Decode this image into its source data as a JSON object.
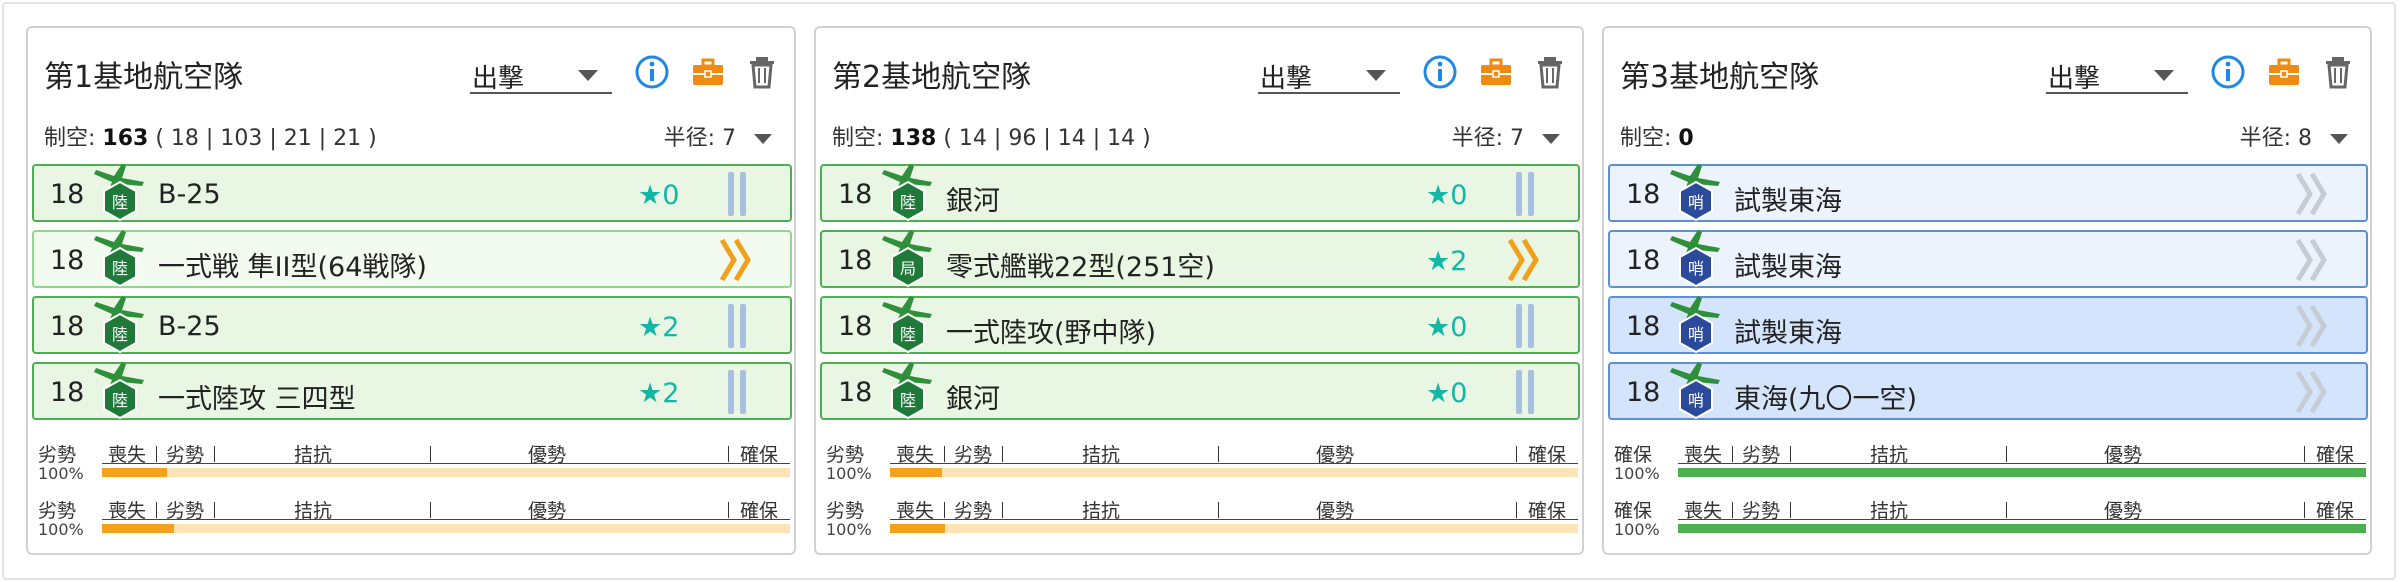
{
  "panels": [
    {
      "title": "第1基地航空隊",
      "mode": "出撃",
      "air_power_label": "制空:",
      "air_power": "163",
      "air_power_detail": "( 18 | 103 | 21 | 21 )",
      "radius_label": "半径:",
      "radius": "7",
      "slots": [
        {
          "count": "18",
          "name": "B-25",
          "star": "★0",
          "proficiency": "bars",
          "badge": "陸",
          "style": "green"
        },
        {
          "count": "18",
          "name": "一式戦 隼II型(64戦隊)",
          "star": "",
          "proficiency": "chevrons",
          "badge": "陸",
          "style": "light"
        },
        {
          "count": "18",
          "name": "B-25",
          "star": "★2",
          "proficiency": "bars",
          "badge": "陸",
          "style": "green"
        },
        {
          "count": "18",
          "name": "一式陸攻 三四型",
          "star": "★2",
          "proficiency": "bars",
          "badge": "陸",
          "style": "green"
        }
      ],
      "bars": [
        {
          "state": "劣勢",
          "pct": "100%",
          "fill": 0.095,
          "color": "orange"
        },
        {
          "state": "劣勢",
          "pct": "100%",
          "fill": 0.105,
          "color": "orange"
        }
      ]
    },
    {
      "title": "第2基地航空隊",
      "mode": "出撃",
      "air_power_label": "制空:",
      "air_power": "138",
      "air_power_detail": "( 14 | 96 | 14 | 14 )",
      "radius_label": "半径:",
      "radius": "7",
      "slots": [
        {
          "count": "18",
          "name": "銀河",
          "star": "★0",
          "proficiency": "bars",
          "badge": "陸",
          "style": "green"
        },
        {
          "count": "18",
          "name": "零式艦戦22型(251空)",
          "star": "★2",
          "proficiency": "chevrons",
          "badge": "局",
          "style": "green"
        },
        {
          "count": "18",
          "name": "一式陸攻(野中隊)",
          "star": "★0",
          "proficiency": "bars",
          "badge": "陸",
          "style": "green"
        },
        {
          "count": "18",
          "name": "銀河",
          "star": "★0",
          "proficiency": "bars",
          "badge": "陸",
          "style": "green"
        }
      ],
      "bars": [
        {
          "state": "劣勢",
          "pct": "100%",
          "fill": 0.075,
          "color": "orange"
        },
        {
          "state": "劣勢",
          "pct": "100%",
          "fill": 0.08,
          "color": "orange"
        }
      ]
    },
    {
      "title": "第3基地航空隊",
      "mode": "出撃",
      "air_power_label": "制空:",
      "air_power": "0",
      "air_power_detail": "",
      "radius_label": "半径:",
      "radius": "8",
      "slots": [
        {
          "count": "18",
          "name": "試製東海",
          "star": "",
          "proficiency": "chevrons-gray",
          "badge": "哨",
          "style": "blue"
        },
        {
          "count": "18",
          "name": "試製東海",
          "star": "",
          "proficiency": "chevrons-gray",
          "badge": "哨",
          "style": "blue"
        },
        {
          "count": "18",
          "name": "試製東海",
          "star": "",
          "proficiency": "chevrons-gray",
          "badge": "哨",
          "style": "blue2"
        },
        {
          "count": "18",
          "name": "東海(九〇一空)",
          "star": "",
          "proficiency": "chevrons-gray",
          "badge": "哨",
          "style": "blue2"
        }
      ],
      "bars": [
        {
          "state": "確保",
          "pct": "100%",
          "fill": 1.0,
          "color": "green"
        },
        {
          "state": "確保",
          "pct": "100%",
          "fill": 1.0,
          "color": "green"
        }
      ]
    }
  ],
  "scale_labels": {
    "loss": "喪失",
    "inferior": "劣勢",
    "parity": "拮抗",
    "superior": "優勢",
    "supremacy": "確保"
  },
  "colors": {
    "green_badge": "#1f7a3a",
    "blue_badge": "#2c4a9a",
    "star": "#13b7a6",
    "orange": "#f6a11c",
    "green": "#4caf50",
    "info": "#1e88e5",
    "briefcase": "#ef8a12"
  },
  "icons": [
    "info-icon",
    "briefcase-icon",
    "trash-icon"
  ]
}
